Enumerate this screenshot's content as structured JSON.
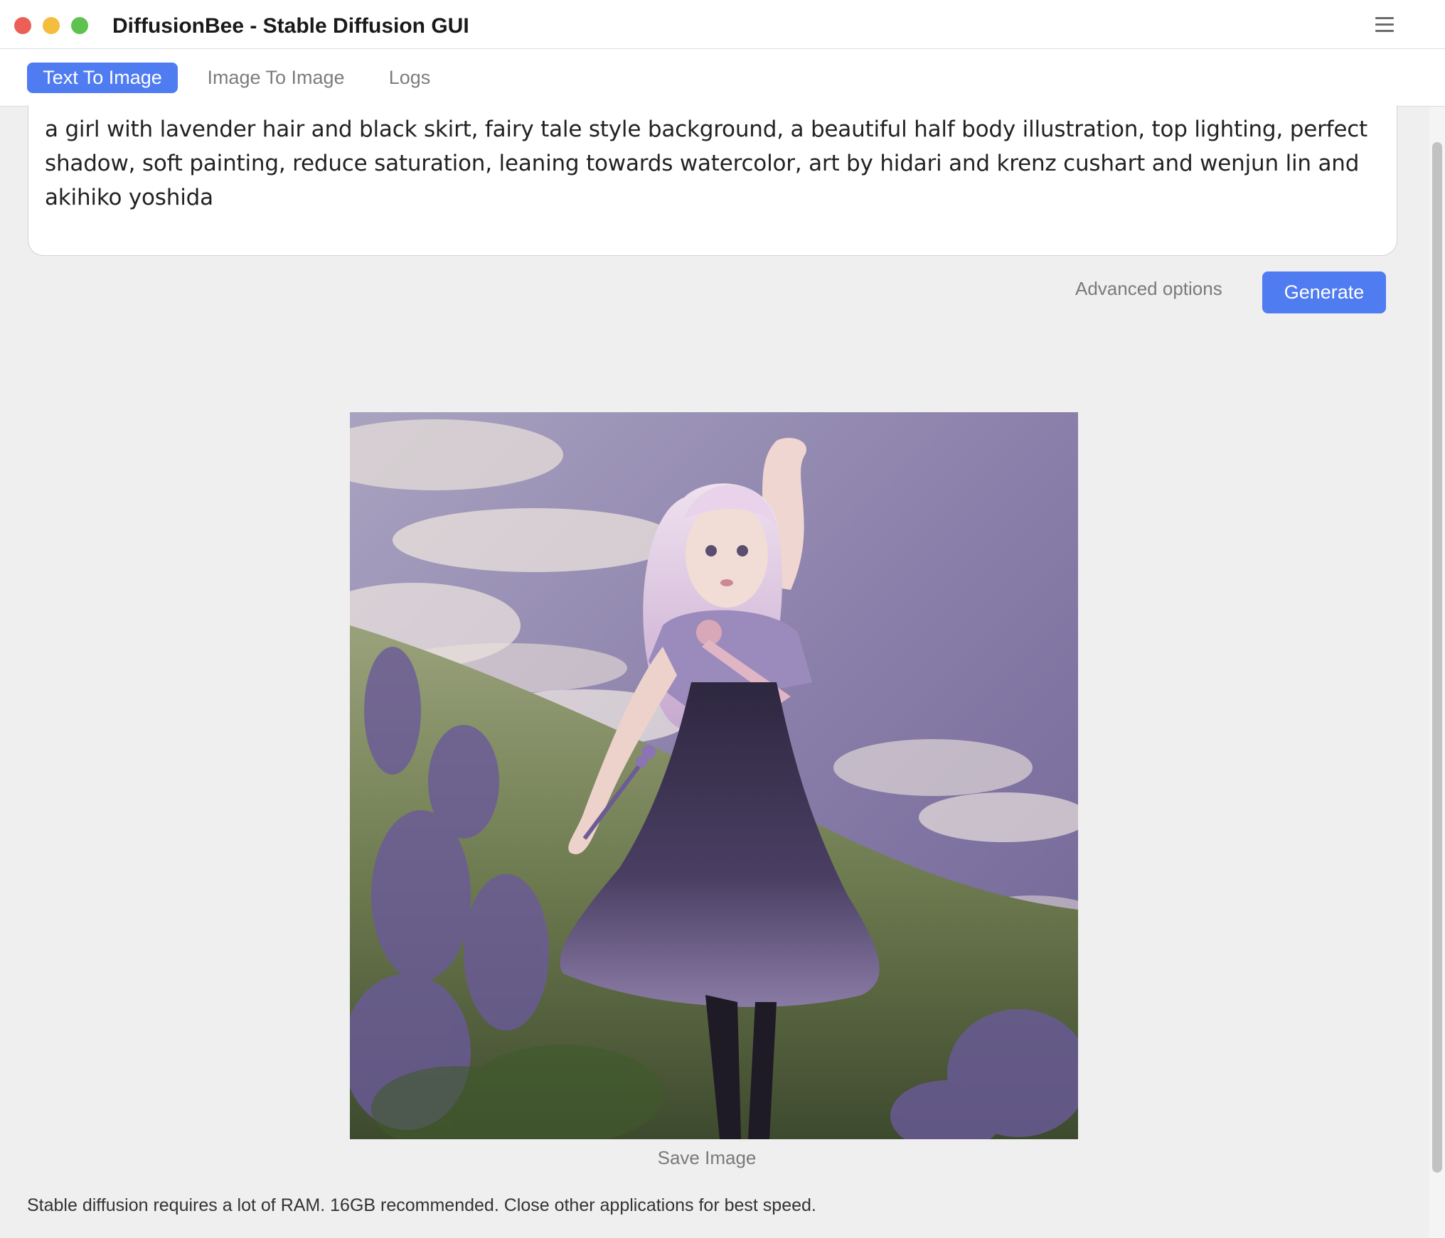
{
  "window": {
    "title": "DiffusionBee - Stable Diffusion GUI"
  },
  "tabs": [
    {
      "label": "Text To Image",
      "active": true
    },
    {
      "label": "Image To Image",
      "active": false
    },
    {
      "label": "Logs",
      "active": false
    }
  ],
  "prompt": {
    "value": "a girl with lavender hair and black skirt, fairy tale style background, a beautiful half body illustration, top lighting, perfect shadow, soft painting, reduce saturation, leaning towards watercolor, art by hidari and krenz cushart and wenjun lin and akihiko yoshida"
  },
  "actions": {
    "advanced_options_label": "Advanced options",
    "generate_label": "Generate",
    "save_image_label": "Save Image"
  },
  "footer": {
    "note": "Stable diffusion requires a lot of RAM. 16GB recommended. Close other applications for best speed."
  },
  "colors": {
    "accent": "#4f7cf0",
    "background": "#efefef",
    "close": "#ec5f57",
    "minimize": "#f4bd3d",
    "maximize": "#5ec24e"
  },
  "icons": {
    "menu": "hamburger-menu-icon"
  }
}
